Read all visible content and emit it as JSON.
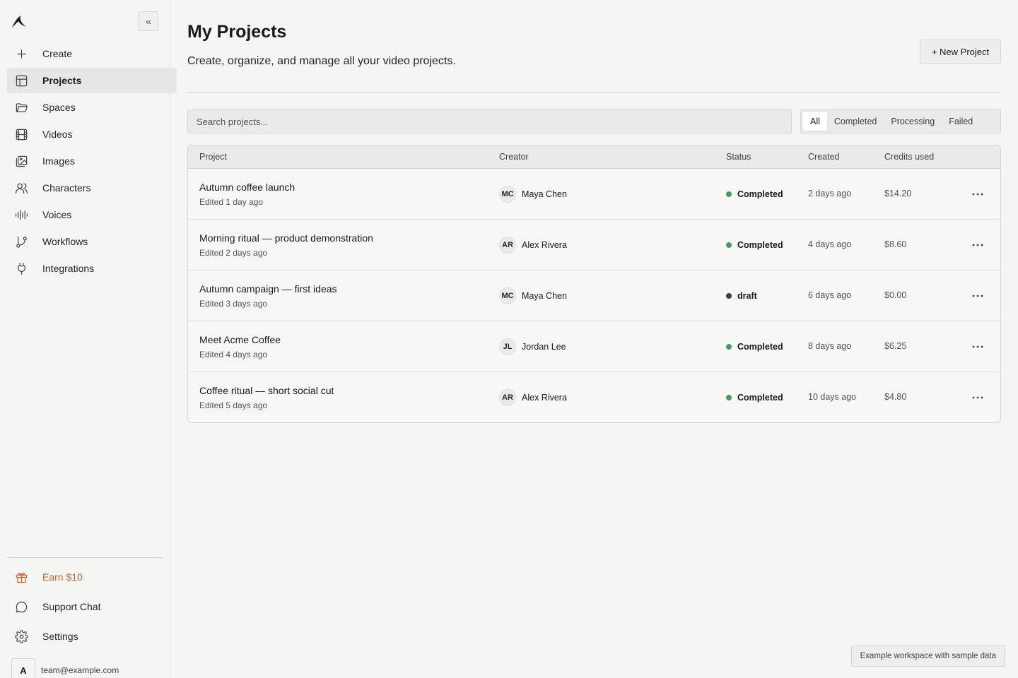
{
  "sidebar": {
    "logo_icon": "brand-logo-icon",
    "collapse_label": "«",
    "items": [
      {
        "label": "Create",
        "icon": "plus-icon"
      },
      {
        "label": "Projects",
        "icon": "layout-icon",
        "active": true
      },
      {
        "label": "Spaces",
        "icon": "folder-icon"
      },
      {
        "label": "Videos",
        "icon": "film-icon"
      },
      {
        "label": "Images",
        "icon": "images-icon"
      },
      {
        "label": "Characters",
        "icon": "users-icon"
      },
      {
        "label": "Voices",
        "icon": "waveform-icon"
      },
      {
        "label": "Workflows",
        "icon": "git-branch-icon"
      },
      {
        "label": "Integrations",
        "icon": "plug-icon"
      }
    ],
    "bottom_items": [
      {
        "label": "Earn $10",
        "icon": "gift-icon",
        "accent": "#c2652a"
      },
      {
        "label": "Support Chat",
        "icon": "message-circle-icon"
      },
      {
        "label": "Settings",
        "icon": "gear-icon"
      }
    ],
    "account": {
      "avatar": "A",
      "email": "team@example.com"
    }
  },
  "header": {
    "title": "My Projects",
    "subtitle": "Create, organize, and manage all your video projects.",
    "new_project_label": "+ New Project"
  },
  "search": {
    "placeholder": "Search projects..."
  },
  "filters": [
    {
      "label": "All",
      "active": true
    },
    {
      "label": "Completed"
    },
    {
      "label": "Processing"
    },
    {
      "label": "Failed"
    }
  ],
  "table": {
    "columns": [
      "Project",
      "Creator",
      "Status",
      "Created",
      "Credits used"
    ],
    "rows": [
      {
        "name": "Autumn coffee launch",
        "edited": "Edited 1 day ago",
        "creator_initials": "MC",
        "creator": "Maya Chen",
        "status": "Completed",
        "status_color": "#4c9a63",
        "created": "2 days ago",
        "credits": "$14.20"
      },
      {
        "name": "Morning ritual — product demonstration",
        "edited": "Edited 2 days ago",
        "creator_initials": "AR",
        "creator": "Alex Rivera",
        "status": "Completed",
        "status_color": "#4c9a63",
        "created": "4 days ago",
        "credits": "$8.60"
      },
      {
        "name": "Autumn campaign — first ideas",
        "edited": "Edited 3 days ago",
        "creator_initials": "MC",
        "creator": "Maya Chen",
        "status": "draft",
        "status_color": "#3f3f3f",
        "created": "6 days ago",
        "credits": "$0.00"
      },
      {
        "name": "Meet Acme Coffee",
        "edited": "Edited 4 days ago",
        "creator_initials": "JL",
        "creator": "Jordan Lee",
        "status": "Completed",
        "status_color": "#4c9a63",
        "created": "8 days ago",
        "credits": "$6.25"
      },
      {
        "name": "Coffee ritual — short social cut",
        "edited": "Edited 5 days ago",
        "creator_initials": "AR",
        "creator": "Alex Rivera",
        "status": "Completed",
        "status_color": "#4c9a63",
        "created": "10 days ago",
        "credits": "$4.80"
      }
    ]
  },
  "toast": "Example workspace with sample data"
}
